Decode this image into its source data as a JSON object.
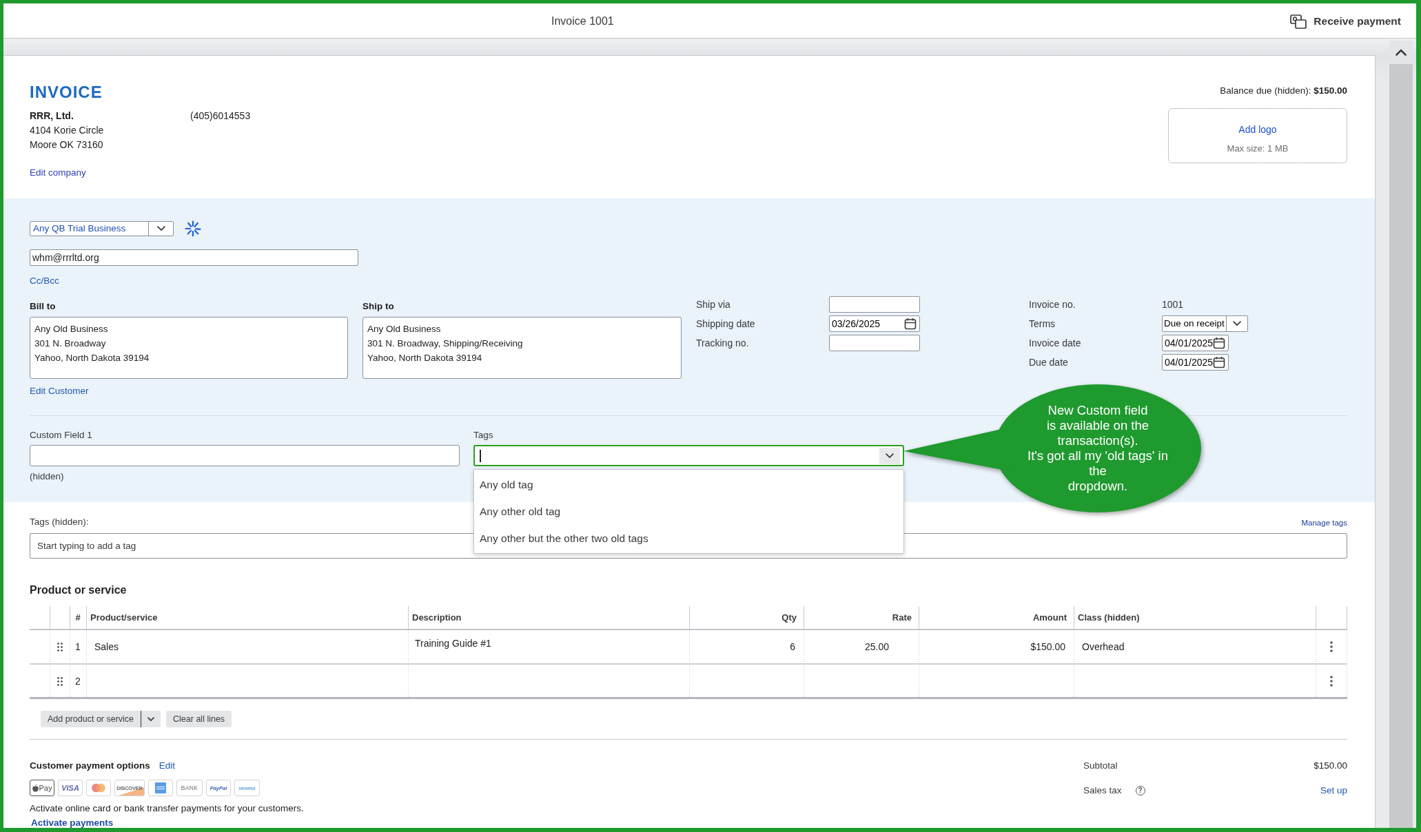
{
  "window": {
    "title": "Invoice 1001",
    "action": "Receive payment"
  },
  "company": {
    "heading": "INVOICE",
    "name": "RRR, Ltd.",
    "phone": "(405)6014553",
    "address": [
      "4104 Korie Circle",
      "Moore OK 73160"
    ],
    "edit_link": "Edit company"
  },
  "balance": "Balance due (hidden): **$150.00**",
  "logo": {
    "link": "Add logo",
    "hint": "Max size: 1 MB"
  },
  "customer": {
    "value": "Any QB Trial Business",
    "email": "whm@rrrltd.org",
    "cc_link": "Cc/Bcc"
  },
  "bill_to": {
    "label": "Bill to",
    "lines": [
      "Any Old Business",
      "301 N. Broadway",
      "Yahoo, North Dakota 39194"
    ],
    "edit_link": "Edit Customer"
  },
  "ship_to": {
    "label": "Ship to",
    "lines": [
      "Any Old Business",
      "301 N. Broadway, Shipping/Receiving",
      "Yahoo, North Dakota 39194"
    ]
  },
  "shipping_fields": [
    {
      "label": "Ship via",
      "kind": "text"
    },
    {
      "label": "Shipping date",
      "kind": "date",
      "value": "03/26/2025"
    },
    {
      "label": "Tracking no.",
      "kind": "text"
    }
  ],
  "invoice_fields": [
    {
      "label": "Invoice no.",
      "kind": "static",
      "value": "1001"
    },
    {
      "label": "Terms",
      "kind": "select",
      "value": "Due on receipt"
    },
    {
      "label": "Invoice date",
      "kind": "date",
      "value": "04/01/2025"
    },
    {
      "label": "Due date",
      "kind": "date",
      "value": "04/01/2025"
    }
  ],
  "custom_field": {
    "label": "Custom Field 1",
    "note": "(hidden)"
  },
  "tags_dropdown": {
    "label": "Tags",
    "focused": true,
    "expanded": true,
    "options": [
      "Any old tag",
      "Any other old tag",
      "Any other but the other two old tags"
    ]
  },
  "callout": {
    "text": "New Custom field\nis available on the\ntransaction(s).\nIt's got all my 'old tags' in\nthe\ndropdown."
  },
  "hidden_tags": {
    "label": "Tags (hidden):",
    "manage_link": "Manage tags",
    "placeholder": "Start typing to add a tag"
  },
  "products": {
    "heading": "Product or service",
    "columns": [
      "#",
      "Product/service",
      "Description",
      "Qty",
      "Rate",
      "Amount",
      "Class (hidden)"
    ],
    "rows": [
      {
        "number": "1",
        "product": "Sales",
        "description": "Training Guide #1",
        "qty": "6",
        "rate": "25.00",
        "amount": "$150.00",
        "class": "Overhead"
      },
      {
        "number": "2"
      }
    ],
    "buttons": [
      {
        "label": "Add product or service",
        "kind": "split"
      },
      {
        "label": "Clear all lines",
        "kind": "plain"
      }
    ]
  },
  "payment": {
    "heading": "Customer payment options",
    "edit_link": "Edit",
    "methods": [
      {
        "kind": "applepay",
        "label": "Pay"
      },
      {
        "kind": "visa",
        "label": "VISA"
      },
      {
        "kind": "mastercard"
      },
      {
        "kind": "discover",
        "label": "DISCOVER"
      },
      {
        "kind": "amex"
      },
      {
        "kind": "bank",
        "label": "BANK"
      },
      {
        "kind": "paypal",
        "label": "PayPal"
      },
      {
        "kind": "venmo",
        "label": "venmo"
      }
    ],
    "note": "Activate online card or bank transfer payments for your customers.",
    "activate_link": "Activate payments"
  },
  "totals": [
    {
      "label": "Subtotal",
      "kind": "amount",
      "value": "$150.00"
    },
    {
      "label": "Sales tax",
      "kind": "link",
      "value": "Set up",
      "help": "?"
    }
  ]
}
